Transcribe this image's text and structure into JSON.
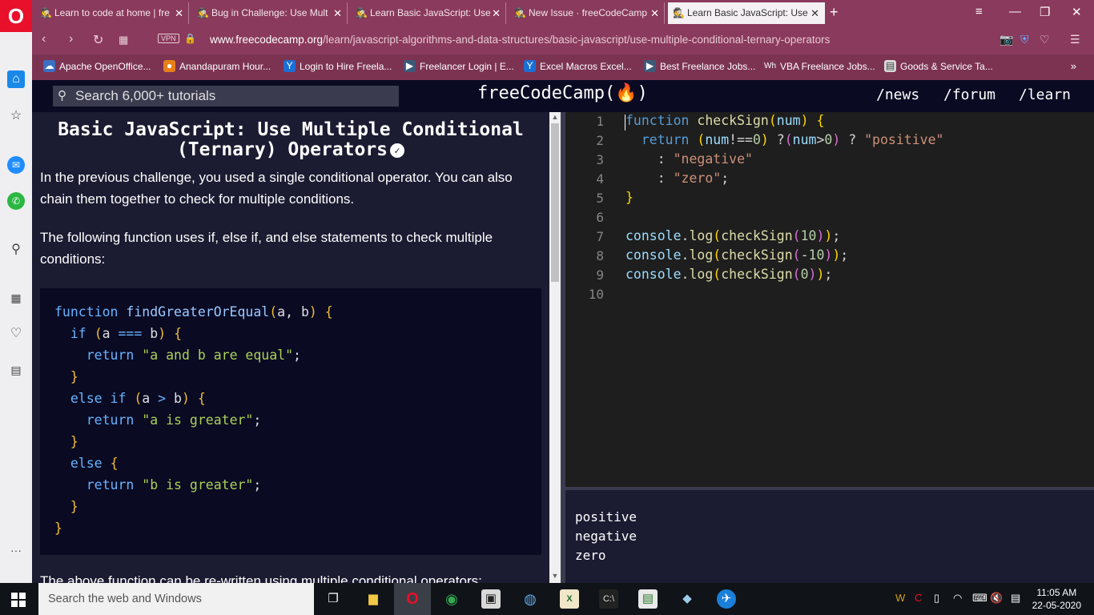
{
  "browser": {
    "tabs": [
      {
        "label": "Learn to code at home | fre",
        "active": false
      },
      {
        "label": "Bug in Challenge: Use Mult",
        "active": false
      },
      {
        "label": "Learn Basic JavaScript: Use",
        "active": false
      },
      {
        "label": "New Issue · freeCodeCamp",
        "active": false
      },
      {
        "label": "Learn Basic JavaScript: Use",
        "active": true
      }
    ],
    "vpn_label": "VPN",
    "url_domain": "www.freecodecamp.org",
    "url_path": "/learn/javascript-algorithms-and-data-structures/basic-javascript/use-multiple-conditional-ternary-operators",
    "bookmarks": [
      "Apache OpenOffice...",
      "Anandapuram Hour...",
      "Login to Hire Freela...",
      "Freelancer Login | E...",
      "Excel Macros Excel...",
      "Best Freelance Jobs...",
      "VBA Freelance Jobs...",
      "Goods & Service Ta..."
    ],
    "bookmarks_more": "»"
  },
  "fcc": {
    "search_placeholder": "Search 6,000+ tutorials",
    "logo": "freeCodeCamp(🔥)",
    "nav": [
      "/news",
      "/forum",
      "/learn"
    ]
  },
  "challenge": {
    "title_line1": "Basic JavaScript: Use Multiple Conditional",
    "title_line2": "(Ternary) Operators",
    "para1": "In the previous challenge, you used a single conditional operator. You can also chain them together to check for multiple conditions.",
    "para2": "The following function uses if, else if, and else statements to check multiple conditions:",
    "example_code": [
      "function findGreaterOrEqual(a, b) {",
      "  if (a === b) {",
      "    return \"a and b are equal\";",
      "  }",
      "  else if (a > b) {",
      "    return \"a is greater\";",
      "  }",
      "  else {",
      "    return \"b is greater\";",
      "  }",
      "}"
    ],
    "para3_cut": "The above function can be re-written using multiple conditional operators:"
  },
  "editor": {
    "line_numbers": [
      "1",
      "2",
      "3",
      "4",
      "5",
      "6",
      "7",
      "8",
      "9",
      "10"
    ],
    "lines": [
      "function checkSign(num) {",
      "  return (num!==0) ?(num>0) ? \"positive\"",
      "    : \"negative\"",
      "    : \"zero\";",
      "}",
      "",
      "console.log(checkSign(10));",
      "console.log(checkSign(-10));",
      "console.log(checkSign(0));",
      ""
    ]
  },
  "output": {
    "lines": [
      "positive",
      "negative",
      "zero"
    ]
  },
  "taskbar": {
    "search_placeholder": "Search the web and Windows",
    "time": "11:05 AM",
    "date": "22-05-2020"
  }
}
